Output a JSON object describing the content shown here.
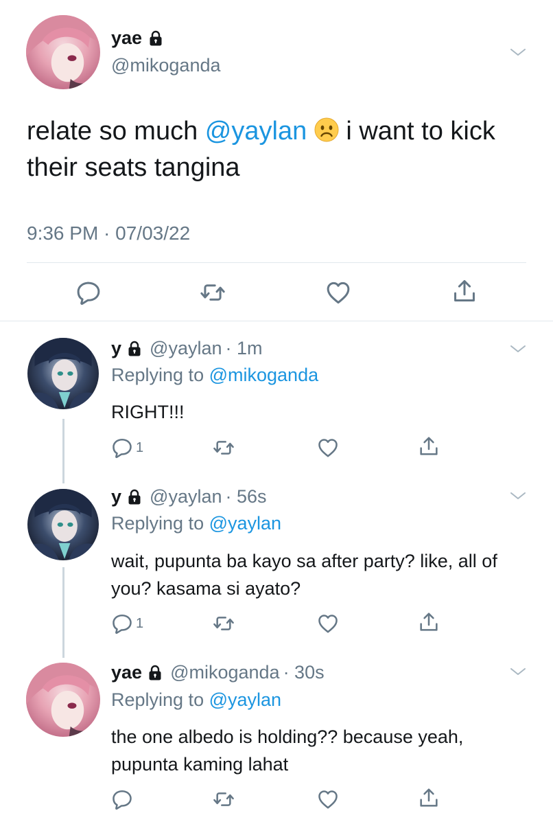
{
  "main_tweet": {
    "display_name": "yae",
    "handle": "@mikoganda",
    "text_before": "relate so much ",
    "mention": "@yaylan",
    "emoji": "☹",
    "text_after": " i want to kick their seats tangina",
    "timestamp": "9:36 PM · 07/03/22"
  },
  "replies": [
    {
      "display_name": "y",
      "handle": "@yaylan",
      "age": "· 1m",
      "replying_prefix": "Replying to",
      "replying_to": "@mikoganda",
      "text": "RIGHT!!!",
      "reply_count": "1"
    },
    {
      "display_name": "y",
      "handle": "@yaylan",
      "age": "· 56s",
      "replying_prefix": "Replying to",
      "replying_to": "@yaylan",
      "text": "wait, pupunta ba kayo sa after party? like, all of you? kasama si ayato?",
      "reply_count": "1"
    },
    {
      "display_name": "yae",
      "handle": "@mikoganda",
      "age": "· 30s",
      "replying_prefix": "Replying to",
      "replying_to": "@yaylan",
      "text": "the one albedo is holding?? because yeah, pupunta kaming lahat",
      "reply_count": ""
    }
  ],
  "icons": {
    "lock": "lock-icon",
    "chevron": "chevron-down-icon",
    "reply": "reply-icon",
    "retweet": "retweet-icon",
    "like": "heart-icon",
    "share": "share-icon"
  },
  "colors": {
    "link": "#1b95e0",
    "secondary_text": "#657786",
    "divider": "#e1e8ed",
    "thread_line": "#ccd6dd"
  }
}
